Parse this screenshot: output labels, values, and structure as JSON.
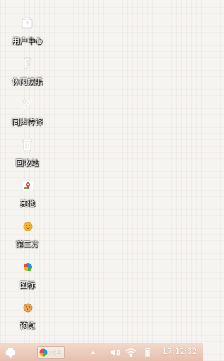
{
  "desktop": {
    "icons": [
      {
        "label": "用户中心",
        "icon": "user-center-icon"
      },
      {
        "label": "休闲娱乐",
        "icon": "entertainment-icon"
      },
      {
        "label": "同声传译",
        "icon": "translate-icon"
      },
      {
        "label": "回收站",
        "icon": "recycle-bin-icon"
      },
      {
        "label": "其他",
        "icon": "map-pin-icon"
      },
      {
        "label": "第三方",
        "icon": "smiley-icon"
      },
      {
        "label": "图标",
        "icon": "pinwheel-icon"
      },
      {
        "label": "预览",
        "icon": "cookie-icon"
      }
    ]
  },
  "taskbar": {
    "start_icon": "clover-icon",
    "task_label": "编程",
    "tray": [
      "up-arrow-icon",
      "volume-icon",
      "wifi-icon",
      "battery-icon"
    ],
    "clock": "17:12:32"
  },
  "colors": {
    "taskbar": "#e7c0ae",
    "background": "#f6f4f1"
  }
}
